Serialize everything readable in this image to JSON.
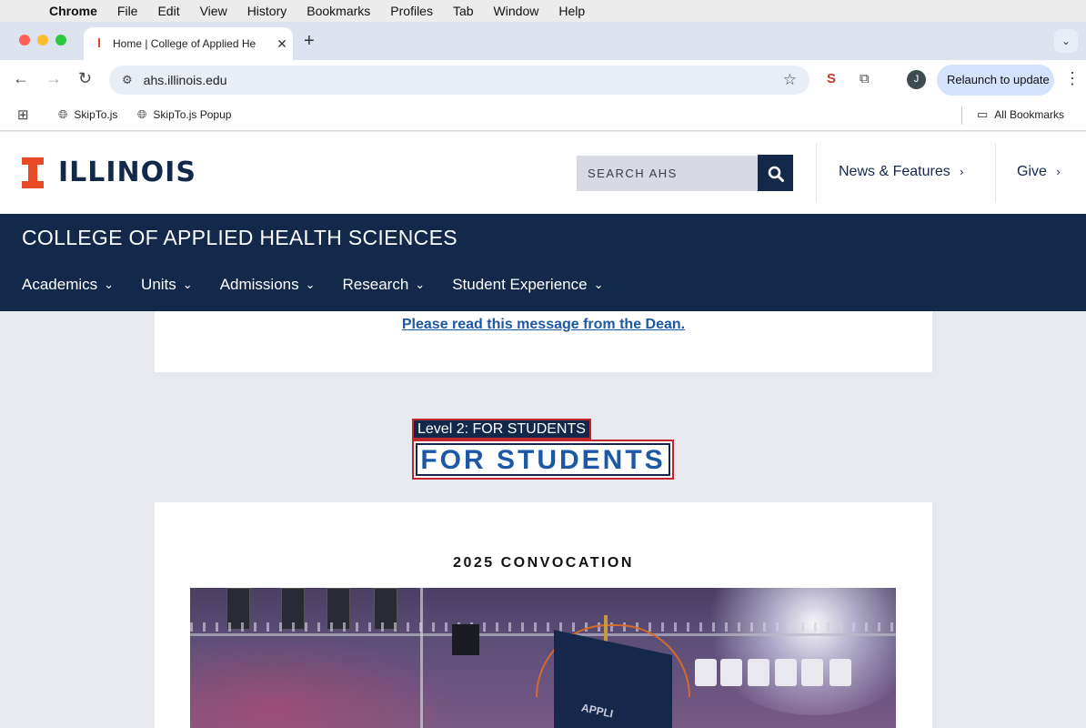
{
  "macos": {
    "app": "Chrome",
    "menu": [
      "File",
      "Edit",
      "View",
      "History",
      "Bookmarks",
      "Profiles",
      "Tab",
      "Window",
      "Help"
    ]
  },
  "browser": {
    "tab_title": "Home | College of Applied He",
    "url": "ahs.illinois.edu",
    "avatar_initial": "J",
    "relaunch_label": "Relaunch to update",
    "bookmarks": [
      "SkipTo.js",
      "SkipTo.js Popup"
    ],
    "all_bookmarks": "All Bookmarks"
  },
  "site": {
    "wordmark": "ILLINOIS",
    "search_placeholder": "SEARCH AHS",
    "header_links": [
      "News & Features",
      "Give"
    ],
    "college_title": "COLLEGE OF APPLIED HEALTH SCIENCES",
    "nav": [
      "Academics",
      "Units",
      "Admissions",
      "Research",
      "Student Experience"
    ],
    "notice_link": "Please read this message from the Dean.",
    "level_tag": "Level 2: FOR STUDENTS",
    "section_heading": "FOR STUDENTS",
    "card_heading": "2025 CONVOCATION",
    "photo_text": "APPLI"
  },
  "colors": {
    "illinois_navy": "#13294b",
    "illinois_orange": "#e84a27",
    "link_blue": "#1d58a7"
  }
}
